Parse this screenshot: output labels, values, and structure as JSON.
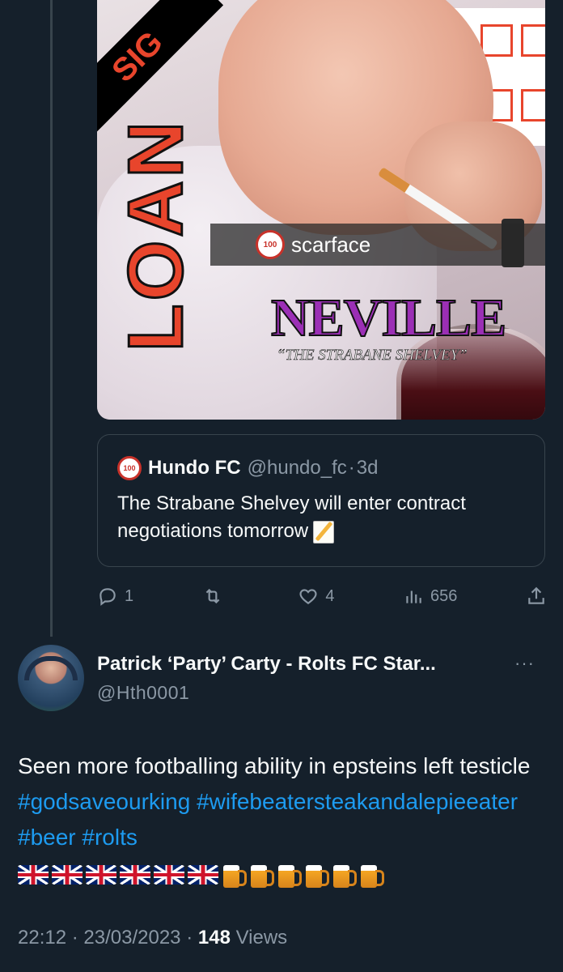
{
  "media": {
    "sash_text": "SIG",
    "loan_text": "LOAN",
    "band_logo": "100",
    "band_text": "scarface",
    "player_name": "NEVILLE",
    "player_nickname": "“THE STRABANE SHELVEY”"
  },
  "quote": {
    "avatar_text": "100",
    "name": "Hundo FC",
    "handle": "@hundo_fc",
    "separator": "·",
    "time": "3d",
    "text": "The Strabane Shelvey will enter contract negotiations tomorrow",
    "emoji": "memo-icon"
  },
  "actions": {
    "reply_count": "1",
    "retweet_count": "",
    "like_count": "4",
    "views_count": "656"
  },
  "tweet": {
    "author": "Patrick ‘Party’ Carty - Rolts FC Star...",
    "handle": "@Hth0001",
    "more": "···",
    "text_plain": "Seen more footballing ability in epsteins left testicle ",
    "hashtags": [
      "#godsaveourking",
      "#wifebeatersteakandalepieeater",
      "#beer",
      "#rolts"
    ],
    "emoji_flags": 6,
    "emoji_beers": 6,
    "time": "22:12",
    "date": "23/03/2023",
    "separator": "·",
    "views_count": "148",
    "views_label": "Views"
  },
  "colors": {
    "background": "#15202b",
    "link": "#1d9bf0",
    "muted": "#8b98a5",
    "accent_orange": "#e8452c",
    "accent_purple": "#9b2fb5"
  }
}
